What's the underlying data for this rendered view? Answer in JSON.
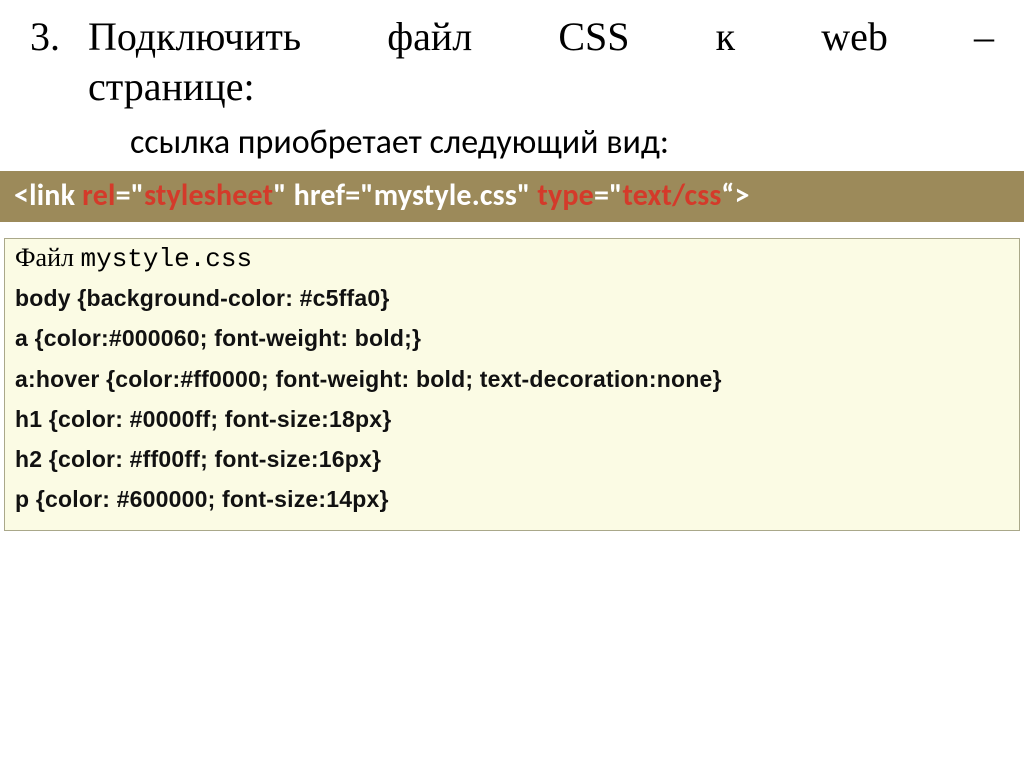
{
  "heading": {
    "number": "3.",
    "line1": "Подключить файл CSS к web –",
    "line2": "странице:"
  },
  "subheading": "ссылка приобретает следующий вид:",
  "link_tag": {
    "p1": "<link ",
    "p2": "rel",
    "p3": "=\"",
    "p4": "stylesheet",
    "p5": "\" href=\"mystyle.css\" ",
    "p6": "type",
    "p7": "=\"",
    "p8": "text/css",
    "p9": "“>"
  },
  "file_label": "Файл ",
  "file_name": "mystyle.css",
  "css_lines": [
    "body {background-color: #c5ffa0}",
    "a {color:#000060; font-weight: bold;}",
    "a:hover {color:#ff0000; font-weight: bold; text-decoration:none}",
    "h1 {color: #0000ff; font-size:18px}",
    "h2 {color: #ff00ff; font-size:16px}",
    "p {color: #600000; font-size:14px}"
  ]
}
